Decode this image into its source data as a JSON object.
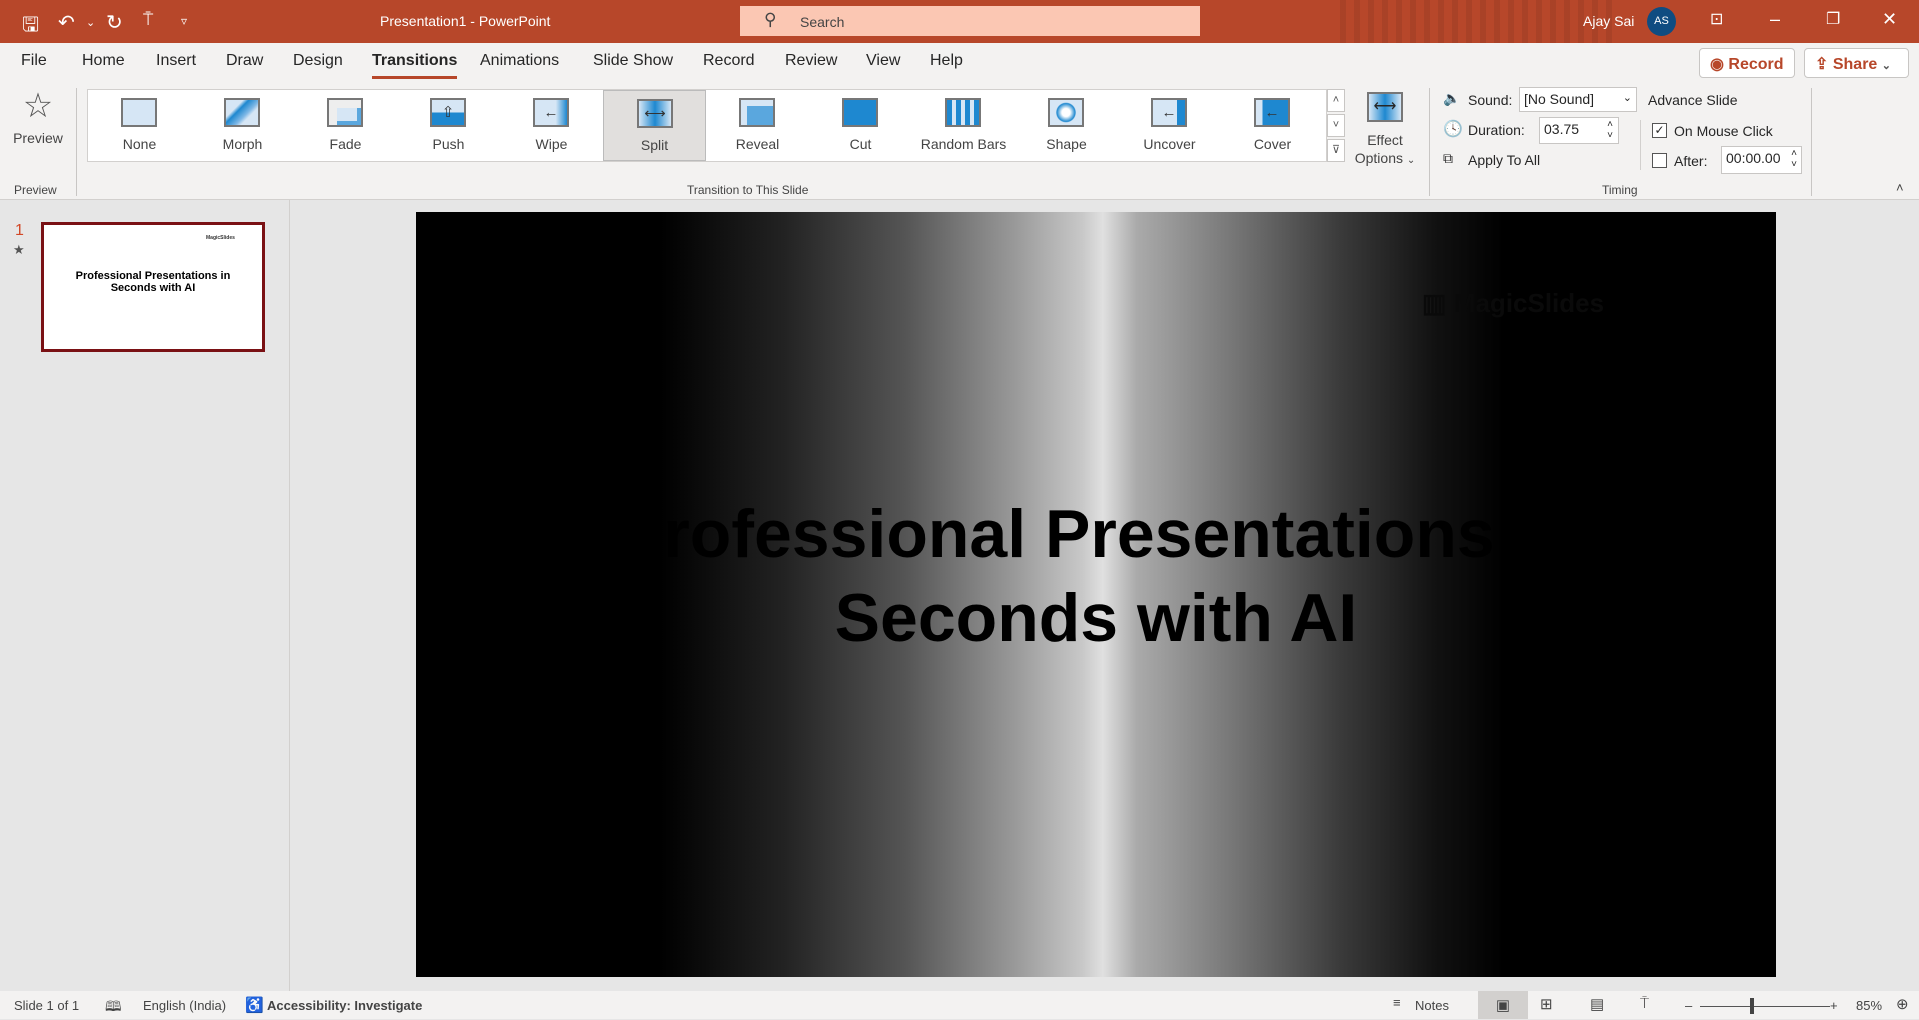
{
  "titlebar": {
    "doc_title": "Presentation1  -  PowerPoint",
    "search_placeholder": "Search",
    "user_name": "Ajay Sai",
    "user_initials": "AS"
  },
  "tabs": [
    "File",
    "Home",
    "Insert",
    "Draw",
    "Design",
    "Transitions",
    "Animations",
    "Slide Show",
    "Record",
    "Review",
    "View",
    "Help"
  ],
  "active_tab": "Transitions",
  "top_buttons": {
    "record": "Record",
    "share": "Share"
  },
  "ribbon": {
    "preview": {
      "button": "Preview",
      "group": "Preview"
    },
    "transitions": [
      "None",
      "Morph",
      "Fade",
      "Push",
      "Wipe",
      "Split",
      "Reveal",
      "Cut",
      "Random Bars",
      "Shape",
      "Uncover",
      "Cover"
    ],
    "selected_transition": "Split",
    "group_label": "Transition to This Slide",
    "effect_options": {
      "line1": "Effect",
      "line2": "Options"
    },
    "timing": {
      "sound_label": "Sound:",
      "sound_value": "[No Sound]",
      "duration_label": "Duration:",
      "duration_value": "03.75",
      "apply_all": "Apply To All",
      "advance_label": "Advance Slide",
      "on_click_label": "On Mouse Click",
      "on_click_checked": true,
      "after_label": "After:",
      "after_checked": false,
      "after_value": "00:00.00",
      "group": "Timing"
    }
  },
  "thumbnail": {
    "number": "1",
    "title": "Professional Presentations in Seconds with AI",
    "logo": "MagicSlides"
  },
  "slide": {
    "title_line1": "Professional Presentations in",
    "title_line2": "Seconds with AI",
    "logo": "MagicSlides"
  },
  "status": {
    "slide_info": "Slide 1 of 1",
    "language": "English (India)",
    "accessibility": "Accessibility: Investigate",
    "notes": "Notes",
    "zoom": "85%"
  },
  "colors": {
    "accent": "#b7472a",
    "thumb_border": "#7a1114"
  }
}
